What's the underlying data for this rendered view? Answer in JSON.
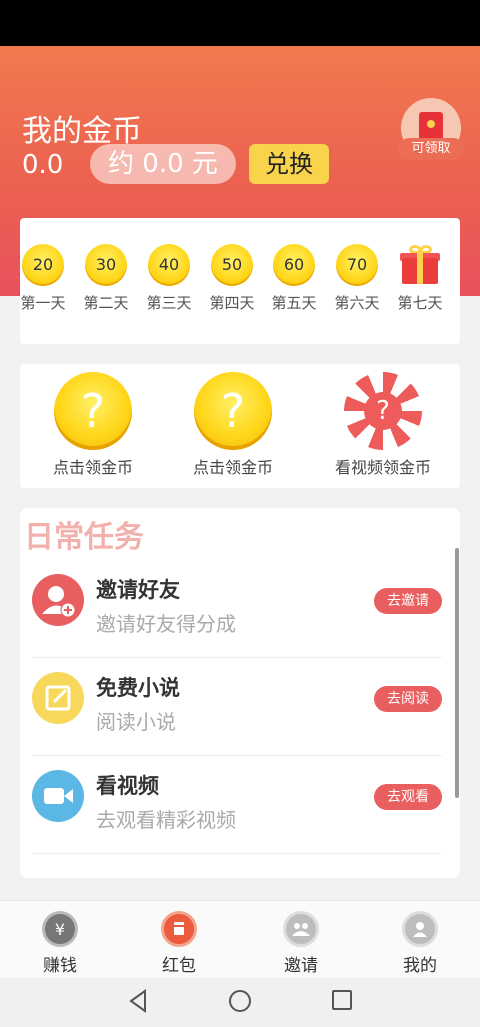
{
  "header": {
    "title": "我的金币",
    "coin_balance": "0.0",
    "cny_value": "约 0.0 元",
    "exchange_label": "兑换",
    "claim_badge": "可领取"
  },
  "checkin": {
    "days": [
      {
        "amount": "20",
        "label": "第一天"
      },
      {
        "amount": "30",
        "label": "第二天"
      },
      {
        "amount": "40",
        "label": "第三天"
      },
      {
        "amount": "50",
        "label": "第四天"
      },
      {
        "amount": "60",
        "label": "第五天"
      },
      {
        "amount": "70",
        "label": "第六天"
      },
      {
        "amount": "",
        "label": "第七天"
      }
    ]
  },
  "coins": [
    {
      "glyph": "?",
      "label": "点击领金币"
    },
    {
      "glyph": "?",
      "label": "点击领金币"
    },
    {
      "glyph": "?",
      "label": "看视频领金币"
    }
  ],
  "tasks": {
    "title": "日常任务",
    "items": [
      {
        "name": "邀请好友",
        "desc": "邀请好友得分成",
        "button": "去邀请",
        "icon": "add-user-icon",
        "color": "#e95f5f"
      },
      {
        "name": "免费小说",
        "desc": "阅读小说",
        "button": "去阅读",
        "icon": "edit-icon",
        "color": "#f7d85a"
      },
      {
        "name": "看视频",
        "desc": "去观看精彩视频",
        "button": "去观看",
        "icon": "video-icon",
        "color": "#5bb8e6"
      }
    ]
  },
  "tabbar": {
    "tabs": [
      {
        "label": "赚钱",
        "icon": "yuan-icon"
      },
      {
        "label": "红包",
        "icon": "red-packet-icon"
      },
      {
        "label": "邀请",
        "icon": "group-icon"
      },
      {
        "label": "我的",
        "icon": "profile-icon"
      }
    ]
  },
  "colors": {
    "header_top": "#f07a4e",
    "header_bottom": "#e9515c",
    "coin_gold": "#ffd619",
    "accent_red": "#e95f5f",
    "tasks_title": "#f3b1ae"
  }
}
